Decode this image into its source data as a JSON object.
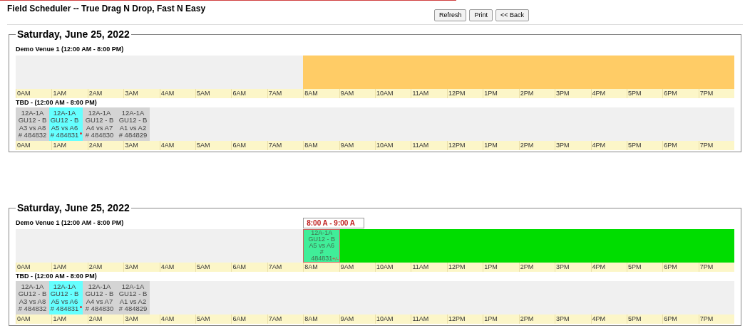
{
  "title": "Field Scheduler -- True Drag N Drop, Fast N Easy",
  "buttons": [
    "Refresh",
    "Print",
    "<< Back"
  ],
  "panels": [
    {
      "date": "Saturday, June 25, 2022",
      "venue": {
        "name": "Demo Venue 1 (12:00 AM - 8:00 PM)",
        "slot": {
          "color": "#ffcc66"
        },
        "hours": [
          "0AM",
          "1AM",
          "2AM",
          "3AM",
          "4AM",
          "5AM",
          "6AM",
          "7AM",
          "8AM",
          "9AM",
          "10AM",
          "11AM",
          "12PM",
          "1PM",
          "2PM",
          "3PM",
          "4PM",
          "5PM",
          "6PM",
          "7PM"
        ]
      },
      "pool": {
        "name": "TBD - (12:00 AM - 8:00 PM)",
        "games": [
          {
            "lines": [
              "12A-1A",
              "GU12 - B",
              "A3 vs A8",
              "# 484832"
            ],
            "selected": false
          },
          {
            "lines": [
              "12A-1A",
              "GU12 - B",
              "A5 vs A6",
              "# 484831"
            ],
            "selected": true
          },
          {
            "lines": [
              "12A-1A",
              "GU12 - B",
              "A4 vs A7",
              "# 484830"
            ],
            "selected": false
          },
          {
            "lines": [
              "12A-1A",
              "GU12 - B",
              "A1 vs A2",
              "# 484829"
            ],
            "selected": false
          }
        ],
        "hours": [
          "0AM",
          "1AM",
          "2AM",
          "3AM",
          "4AM",
          "5AM",
          "6AM",
          "7AM",
          "8AM",
          "9AM",
          "10AM",
          "11AM",
          "12PM",
          "1PM",
          "2PM",
          "3PM",
          "4PM",
          "5PM",
          "6PM",
          "7PM"
        ]
      }
    },
    {
      "date": "Saturday, June 25, 2022",
      "tooltip": "8:00 A - 9:00 A",
      "venue": {
        "name": "Demo Venue 1 (12:00 AM - 8:00 PM)",
        "slot": {
          "color": "#00dd00"
        },
        "dropped": {
          "lines": [
            "12A-1A",
            "GU12 - B",
            "A5 vs A6",
            "#",
            "484831"
          ],
          "handle": "+/-"
        },
        "hours": [
          "0AM",
          "1AM",
          "2AM",
          "3AM",
          "4AM",
          "5AM",
          "6AM",
          "7AM",
          "8AM",
          "9AM",
          "10AM",
          "11AM",
          "12PM",
          "1PM",
          "2PM",
          "3PM",
          "4PM",
          "5PM",
          "6PM",
          "7PM"
        ]
      },
      "pool": {
        "name": "TBD - (12:00 AM - 8:00 PM)",
        "games": [
          {
            "lines": [
              "12A-1A",
              "GU12 - B",
              "A3 vs A8",
              "# 484832"
            ],
            "selected": false
          },
          {
            "lines": [
              "12A-1A",
              "GU12 - B",
              "A5 vs A6",
              "# 484831"
            ],
            "selected": true
          },
          {
            "lines": [
              "12A-1A",
              "GU12 - B",
              "A4 vs A7",
              "# 484830"
            ],
            "selected": false
          },
          {
            "lines": [
              "12A-1A",
              "GU12 - B",
              "A1 vs A2",
              "# 484829"
            ],
            "selected": false
          }
        ],
        "hours": [
          "0AM",
          "1AM",
          "2AM",
          "3AM",
          "4AM",
          "5AM",
          "6AM",
          "7AM",
          "8AM",
          "9AM",
          "10AM",
          "11AM",
          "12PM",
          "1PM",
          "2PM",
          "3PM",
          "4PM",
          "5PM",
          "6PM",
          "7PM"
        ]
      }
    }
  ]
}
